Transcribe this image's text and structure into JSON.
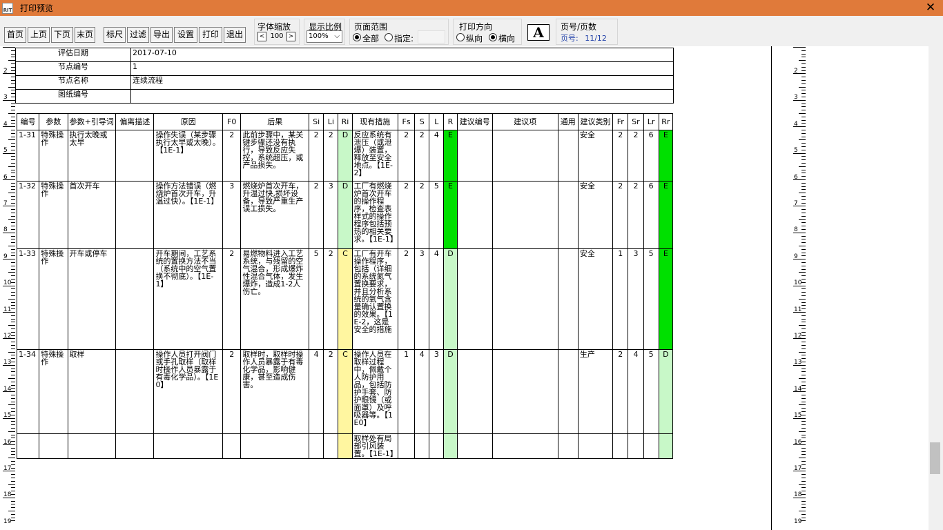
{
  "window": {
    "title": "打印预览",
    "icon_text": "RIT"
  },
  "toolbar": {
    "nav": [
      "首页",
      "上页",
      "下页",
      "末页"
    ],
    "tools": [
      "标尺",
      "过滤",
      "导出",
      "设置",
      "打印",
      "退出"
    ],
    "font_zoom": {
      "title": "字体缩放",
      "value": "100",
      "dec": "<",
      "inc": ">"
    },
    "display_ratio": {
      "title": "显示比例",
      "value": "100%"
    },
    "page_range": {
      "title": "页面范围",
      "all": "全部",
      "specify": "指定:"
    },
    "orientation": {
      "title": "打印方向",
      "portrait": "纵向",
      "landscape": "横向"
    },
    "font_icon": "A",
    "page_info": {
      "title": "页号/页数",
      "label": "页号:",
      "value": "11/12"
    }
  },
  "ruler": [
    "2",
    "3",
    "4",
    "5",
    "6",
    "7",
    "8",
    "9",
    "10",
    "11",
    "12",
    "13",
    "14",
    "15",
    "16",
    "17",
    "18",
    "19"
  ],
  "info_rows": [
    {
      "label": "评估日期",
      "value": "2017-07-10"
    },
    {
      "label": "节点编号",
      "value": "1"
    },
    {
      "label": "节点名称",
      "value": "连续流程"
    },
    {
      "label": "图纸编号",
      "value": ""
    }
  ],
  "table_headers": [
    "编号",
    "参数",
    "参数+引导词",
    "偏离描述",
    "原因",
    "F0",
    "后果",
    "Si",
    "Li",
    "Ri",
    "现有措施",
    "Fs",
    "S",
    "L",
    "R",
    "建议编号",
    "建议项",
    "通用",
    "建议类别",
    "Fr",
    "Sr",
    "Lr",
    "Rr"
  ],
  "rows": [
    {
      "id": "1-31",
      "param": "特殊操作",
      "guide": "执行太晚或太早",
      "dev": "",
      "cause": "操作失误（某步骤执行太早或太晚）。【1E-1】",
      "f0": "2",
      "conseq": "此前步骤中，某关键步骤还没有执行，导致反应失控，系统超压，或产品损失。",
      "si": "2",
      "li": "2",
      "ri": "D",
      "measure": "反应系统有泄压（或泄爆）装置，释放至安全地点。【1E-2】",
      "fs": "2",
      "s": "2",
      "l": "4",
      "r": "E",
      "sug_id": "",
      "sug": "",
      "common": "",
      "cat": "安全",
      "fr": "2",
      "sr": "2",
      "lr": "6",
      "rr": "E"
    },
    {
      "id": "1-32",
      "param": "特殊操作",
      "guide": "首次开车",
      "dev": "",
      "cause": "操作方法错误（燃烧炉首次开车，升温过快）。【1E-1】",
      "f0": "3",
      "conseq": "燃烧炉首次开车，升温过快,损坏设备，导致严重生产误工损失。",
      "si": "2",
      "li": "3",
      "ri": "D",
      "measure": "工厂有燃烧炉首次开车的操作程序，检查表样式的操作程序包括预热的相关要求。【1E-1】",
      "fs": "2",
      "s": "2",
      "l": "5",
      "r": "E",
      "sug_id": "",
      "sug": "",
      "common": "",
      "cat": "安全",
      "fr": "2",
      "sr": "2",
      "lr": "6",
      "rr": "E"
    },
    {
      "id": "1-33",
      "param": "特殊操作",
      "guide": "开车或停车",
      "dev": "",
      "cause": "开车期间，工艺系统的置换方法不当（系统中的空气置换不彻底）。【1E-1】",
      "f0": "2",
      "conseq": "易燃物料进入工艺系统，与残留的空气混合，形成爆炸性混合气体，发生爆炸，造成1-2人伤亡。",
      "si": "5",
      "li": "2",
      "ri": "C",
      "measure": "工厂有开车操作程序，包括（详细的系统氮气置换要求，并且分析系统的氧气含量确认置换的效果。【1E-2，这是安全的措施",
      "fs": "2",
      "s": "3",
      "l": "4",
      "r": "D",
      "sug_id": "",
      "sug": "",
      "common": "",
      "cat": "安全",
      "fr": "1",
      "sr": "3",
      "lr": "5",
      "rr": "E"
    },
    {
      "id": "1-34",
      "param": "特殊操作",
      "guide": "取样",
      "dev": "",
      "cause": "操作人员打开阀门或手孔取样（取样时操作人员暴露于有毒化学品）。【1E0】",
      "f0": "2",
      "conseq": "取样时，取样时操作人员暴露于有毒化学品，影响健康，甚至造成伤害。",
      "si": "4",
      "li": "2",
      "ri": "C",
      "measure": "操作人员在取样过程中，佩戴个人防护用品，包括防护手套、防护眼镜（或面罩）及呼吸器等。【1E0】",
      "fs": "1",
      "s": "4",
      "l": "3",
      "r": "D",
      "sug_id": "",
      "sug": "",
      "common": "",
      "cat": "生产",
      "fr": "2",
      "sr": "4",
      "lr": "5",
      "rr": "D"
    }
  ],
  "extra_measure": "取样处有局部引风装置。【1E-1】"
}
